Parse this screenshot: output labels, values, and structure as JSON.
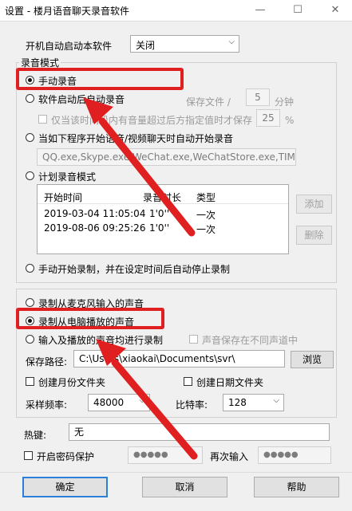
{
  "window": {
    "title": "设置 - 楼月语音聊天录音软件",
    "minimize": "—",
    "maximize": "☐",
    "close": "✕"
  },
  "startup": {
    "label": "开机自动启动本软件",
    "value": "关闭"
  },
  "record_mode": {
    "group_title": "录音模式",
    "manual": "手动录音",
    "auto_after_start": "软件启动后自动录音",
    "save_file_label": "保存文件 /",
    "save_file_minutes": "5",
    "minutes_unit": "分钟",
    "only_when_label": "仅当该时间段内有音量超过后方指定值时才保存",
    "threshold": "25",
    "percent_unit": "%",
    "when_program": "当如下程序开始语音/视频聊天时自动开始录音",
    "program_list": "QQ.exe,Skype.exe,WeChat.exe,WeChatStore.exe,TIM.exe",
    "scheduled": "计划录音模式",
    "schedule_headers": [
      "开始时间",
      "录音时长",
      "类型"
    ],
    "schedule_rows": [
      [
        "2019-03-04 11:05:04",
        "1'0''",
        "一次"
      ],
      [
        "2019-08-06 09:25:26",
        "1'0''",
        "一次"
      ]
    ],
    "add_button": "添加",
    "delete_button": "删除",
    "manual_timed_stop": "手动开始录制，并在设定时间后自动停止录制"
  },
  "source": {
    "mic": "录制从麦克风输入的声音",
    "speaker": "录制从电脑播放的声音",
    "both": "输入及播放的声音均进行录制",
    "separate_channels": "声音保存在不同声道中"
  },
  "save": {
    "path_label": "保存路径:",
    "path_value": "C:\\Users\\xiaokai\\Documents\\svr\\",
    "browse_button": "浏览",
    "monthly_folder": "创建月份文件夹",
    "daily_folder": "创建日期文件夹"
  },
  "format": {
    "sample_rate_label": "采样频率:",
    "sample_rate_value": "48000",
    "bitrate_label": "比特率:",
    "bitrate_value": "128"
  },
  "hotkey": {
    "label": "热键:",
    "value": "无"
  },
  "password": {
    "enable_label": "开启密码保护",
    "password_value": "●●●●●",
    "repeat_label": "再次输入",
    "repeat_value": "●●●●●"
  },
  "footer": {
    "ok": "确定",
    "cancel": "取消",
    "help": "帮助"
  },
  "colors": {
    "highlight": "#e02020",
    "accent": "#2b7fd8"
  }
}
